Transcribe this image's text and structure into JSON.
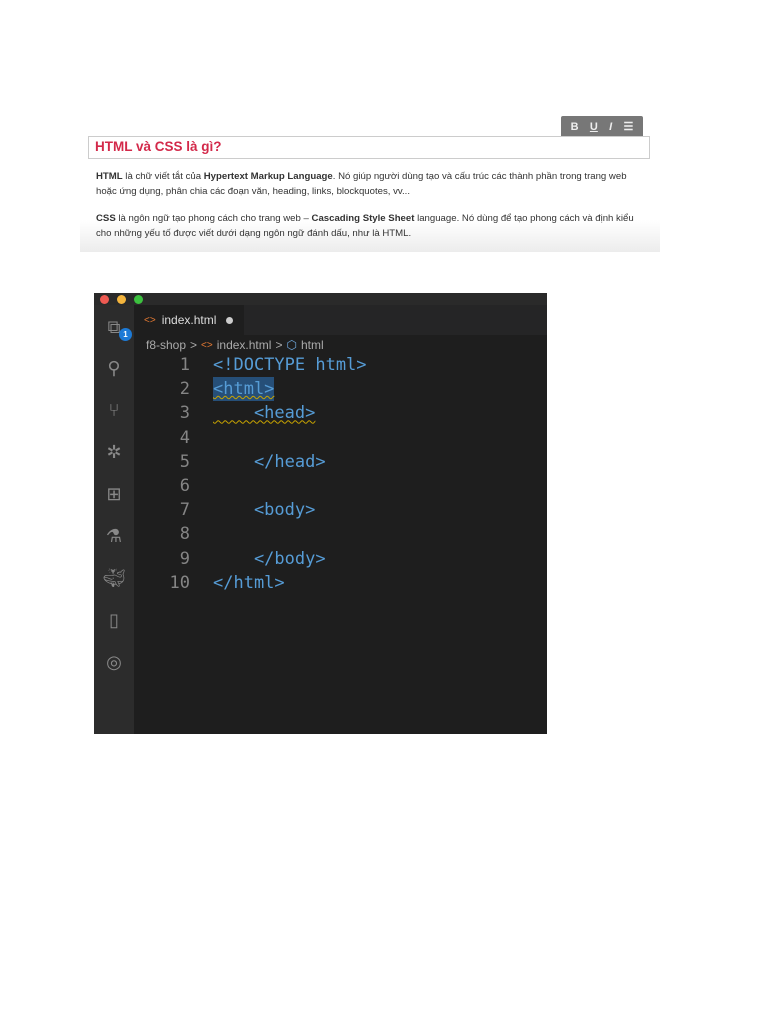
{
  "article": {
    "format_buttons": [
      "B",
      "U",
      "I",
      "☰"
    ],
    "heading": "HTML và CSS là gì?",
    "p1": {
      "b1": "HTML",
      "t1": " là chữ viết tắt của ",
      "b2": "Hypertext Markup Language",
      "t2": ". Nó giúp người dùng tạo và cấu trúc các thành phần trong trang web hoặc ứng dụng, phân chia các đoạn văn, heading, links, blockquotes, vv..."
    },
    "p2": {
      "b1": "CSS",
      "t1": " là ngôn ngữ tạo phong cách cho trang web – ",
      "b2": "Cascading Style Sheet",
      "t2": " language. Nó dùng để tạo phong cách và định kiểu cho những yếu tố được viết dưới dạng ngôn ngữ đánh dấu, như là HTML."
    }
  },
  "editor": {
    "tab": "index.html",
    "explorer_badge": "1",
    "breadcrumb": [
      "f8-shop",
      ">",
      "index.html",
      ">",
      "html"
    ],
    "lines": [
      {
        "n": "1",
        "code": "<!DOCTYPE html>"
      },
      {
        "n": "2",
        "code": "<html>"
      },
      {
        "n": "3",
        "code": "    <head>"
      },
      {
        "n": "4",
        "code": ""
      },
      {
        "n": "5",
        "code": "    </head>"
      },
      {
        "n": "6",
        "code": ""
      },
      {
        "n": "7",
        "code": "    <body>"
      },
      {
        "n": "8",
        "code": ""
      },
      {
        "n": "9",
        "code": "    </body>"
      },
      {
        "n": "10",
        "code": "</html>"
      }
    ]
  }
}
